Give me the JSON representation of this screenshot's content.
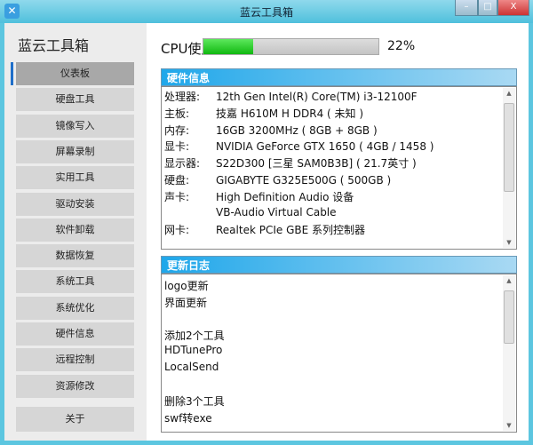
{
  "window": {
    "title": "蓝云工具箱",
    "minimize": "–",
    "maximize": "□",
    "close": "X"
  },
  "sidebar": {
    "brand": "蓝云工具箱",
    "items": [
      "仪表板",
      "硬盘工具",
      "镜像写入",
      "屏幕录制",
      "实用工具",
      "驱动安装",
      "软件卸载",
      "数据恢复",
      "系统工具",
      "系统优化",
      "硬件信息",
      "远程控制",
      "资源修改"
    ],
    "about": "关于"
  },
  "cpu": {
    "label": "CPU使用率",
    "percent_text": "22%",
    "percent": 22
  },
  "hardware": {
    "title": "硬件信息",
    "rows": [
      {
        "k": "处理器:",
        "v": "12th Gen Intel(R) Core(TM) i3-12100F"
      },
      {
        "k": "主板:",
        "v": "技嘉 H610M H DDR4 ( 未知 )"
      },
      {
        "k": "内存:",
        "v": "16GB 3200MHz ( 8GB + 8GB )"
      },
      {
        "k": "显卡:",
        "v": "NVIDIA GeForce GTX 1650 ( 4GB / 1458 )"
      },
      {
        "k": "显示器:",
        "v": "S22D300 [三星 SAM0B3B] ( 21.7英寸 )"
      },
      {
        "k": "硬盘:",
        "v": "GIGABYTE G325E500G ( 500GB )"
      },
      {
        "k": "声卡:",
        "v": "High Definition Audio 设备"
      },
      {
        "k": "",
        "v": "VB-Audio Virtual Cable"
      },
      {
        "k": "网卡:",
        "v": "Realtek PCIe GBE 系列控制器"
      }
    ]
  },
  "changelog": {
    "title": "更新日志",
    "lines": [
      "logo更新",
      "界面更新",
      "",
      "添加2个工具",
      "HDTunePro",
      "LocalSend",
      "",
      "删除3个工具",
      "swf转exe"
    ]
  }
}
